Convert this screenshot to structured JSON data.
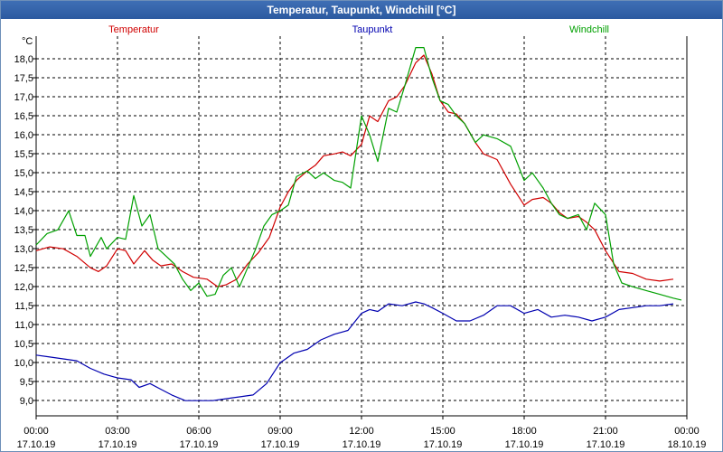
{
  "window": {
    "title": "Temperatur, Taupunkt, Windchill [°C]"
  },
  "chart_data": {
    "type": "line",
    "title": "Temperatur, Taupunkt, Windchill [°C]",
    "ylabel": "°C",
    "ylim": [
      8.6,
      18.6
    ],
    "y_ticks": [
      "9,0",
      "9,5",
      "10,0",
      "10,5",
      "11,0",
      "11,5",
      "12,0",
      "12,5",
      "13,0",
      "13,5",
      "14,0",
      "14,5",
      "15,0",
      "15,5",
      "16,0",
      "16,5",
      "17,0",
      "17,5",
      "18,0"
    ],
    "y_tick_values": [
      9.0,
      9.5,
      10.0,
      10.5,
      11.0,
      11.5,
      12.0,
      12.5,
      13.0,
      13.5,
      14.0,
      14.5,
      15.0,
      15.5,
      16.0,
      16.5,
      17.0,
      17.5,
      18.0
    ],
    "xlim": [
      0,
      24
    ],
    "x_ticks": [
      {
        "time": "00:00",
        "date": "17.10.19"
      },
      {
        "time": "03:00",
        "date": "17.10.19"
      },
      {
        "time": "06:00",
        "date": "17.10.19"
      },
      {
        "time": "09:00",
        "date": "17.10.19"
      },
      {
        "time": "12:00",
        "date": "17.10.19"
      },
      {
        "time": "15:00",
        "date": "17.10.19"
      },
      {
        "time": "18:00",
        "date": "17.10.19"
      },
      {
        "time": "21:00",
        "date": "17.10.19"
      },
      {
        "time": "00:00",
        "date": "18.10.19"
      }
    ],
    "grid": true,
    "legend_position": "top",
    "series": [
      {
        "name": "Temperatur",
        "color": "#d00000",
        "points": [
          [
            0,
            12.95
          ],
          [
            0.5,
            13.05
          ],
          [
            1,
            13.0
          ],
          [
            1.5,
            12.8
          ],
          [
            2,
            12.5
          ],
          [
            2.3,
            12.4
          ],
          [
            2.6,
            12.55
          ],
          [
            3,
            13.0
          ],
          [
            3.3,
            12.95
          ],
          [
            3.6,
            12.6
          ],
          [
            4,
            12.95
          ],
          [
            4.3,
            12.7
          ],
          [
            4.6,
            12.55
          ],
          [
            5,
            12.6
          ],
          [
            5.4,
            12.4
          ],
          [
            5.8,
            12.25
          ],
          [
            6.3,
            12.2
          ],
          [
            6.7,
            12.0
          ],
          [
            7,
            12.05
          ],
          [
            7.4,
            12.2
          ],
          [
            7.8,
            12.6
          ],
          [
            8.2,
            12.9
          ],
          [
            8.6,
            13.3
          ],
          [
            9,
            14.1
          ],
          [
            9.3,
            14.5
          ],
          [
            9.6,
            14.8
          ],
          [
            10,
            15.05
          ],
          [
            10.3,
            15.2
          ],
          [
            10.6,
            15.45
          ],
          [
            11,
            15.5
          ],
          [
            11.3,
            15.55
          ],
          [
            11.6,
            15.45
          ],
          [
            12,
            15.75
          ],
          [
            12.3,
            16.5
          ],
          [
            12.6,
            16.35
          ],
          [
            13,
            16.9
          ],
          [
            13.3,
            17.0
          ],
          [
            13.6,
            17.3
          ],
          [
            14,
            17.9
          ],
          [
            14.3,
            18.1
          ],
          [
            14.6,
            17.6
          ],
          [
            14.9,
            16.9
          ],
          [
            15.2,
            16.6
          ],
          [
            15.5,
            16.55
          ],
          [
            15.8,
            16.3
          ],
          [
            16.2,
            15.8
          ],
          [
            16.5,
            15.5
          ],
          [
            17,
            15.35
          ],
          [
            17.5,
            14.7
          ],
          [
            18,
            14.15
          ],
          [
            18.3,
            14.3
          ],
          [
            18.7,
            14.35
          ],
          [
            19,
            14.2
          ],
          [
            19.3,
            13.95
          ],
          [
            19.6,
            13.8
          ],
          [
            20,
            13.85
          ],
          [
            20.3,
            13.7
          ],
          [
            20.6,
            13.5
          ],
          [
            21,
            12.95
          ],
          [
            21.5,
            12.4
          ],
          [
            22,
            12.35
          ],
          [
            22.5,
            12.2
          ],
          [
            23,
            12.15
          ],
          [
            23.5,
            12.2
          ]
        ]
      },
      {
        "name": "Taupunkt",
        "color": "#0000b0",
        "points": [
          [
            0,
            10.2
          ],
          [
            0.5,
            10.15
          ],
          [
            1,
            10.1
          ],
          [
            1.5,
            10.05
          ],
          [
            2,
            9.85
          ],
          [
            2.5,
            9.7
          ],
          [
            3,
            9.6
          ],
          [
            3.5,
            9.55
          ],
          [
            3.8,
            9.35
          ],
          [
            4.2,
            9.45
          ],
          [
            4.6,
            9.3
          ],
          [
            5,
            9.15
          ],
          [
            5.5,
            9.0
          ],
          [
            6,
            9.0
          ],
          [
            6.5,
            9.0
          ],
          [
            7,
            9.05
          ],
          [
            7.5,
            9.1
          ],
          [
            8,
            9.15
          ],
          [
            8.5,
            9.45
          ],
          [
            9,
            10.0
          ],
          [
            9.5,
            10.25
          ],
          [
            10,
            10.35
          ],
          [
            10.5,
            10.6
          ],
          [
            11,
            10.75
          ],
          [
            11.5,
            10.85
          ],
          [
            12,
            11.3
          ],
          [
            12.3,
            11.4
          ],
          [
            12.6,
            11.35
          ],
          [
            13,
            11.55
          ],
          [
            13.5,
            11.5
          ],
          [
            14,
            11.6
          ],
          [
            14.3,
            11.55
          ],
          [
            14.6,
            11.45
          ],
          [
            15,
            11.3
          ],
          [
            15.5,
            11.1
          ],
          [
            16,
            11.1
          ],
          [
            16.5,
            11.25
          ],
          [
            17,
            11.5
          ],
          [
            17.5,
            11.5
          ],
          [
            18,
            11.3
          ],
          [
            18.5,
            11.4
          ],
          [
            19,
            11.2
          ],
          [
            19.5,
            11.25
          ],
          [
            20,
            11.2
          ],
          [
            20.5,
            11.1
          ],
          [
            21,
            11.2
          ],
          [
            21.5,
            11.4
          ],
          [
            22,
            11.45
          ],
          [
            22.5,
            11.5
          ],
          [
            23,
            11.5
          ],
          [
            23.5,
            11.55
          ]
        ]
      },
      {
        "name": "Windchill",
        "color": "#00a000",
        "points": [
          [
            0,
            13.1
          ],
          [
            0.4,
            13.4
          ],
          [
            0.8,
            13.5
          ],
          [
            1.2,
            14.0
          ],
          [
            1.5,
            13.35
          ],
          [
            1.8,
            13.35
          ],
          [
            2,
            12.8
          ],
          [
            2.4,
            13.3
          ],
          [
            2.6,
            13.0
          ],
          [
            3,
            13.3
          ],
          [
            3.3,
            13.25
          ],
          [
            3.6,
            14.4
          ],
          [
            3.9,
            13.6
          ],
          [
            4.2,
            13.9
          ],
          [
            4.5,
            13.0
          ],
          [
            4.8,
            12.8
          ],
          [
            5.1,
            12.6
          ],
          [
            5.4,
            12.2
          ],
          [
            5.7,
            11.9
          ],
          [
            6,
            12.1
          ],
          [
            6.3,
            11.75
          ],
          [
            6.6,
            11.8
          ],
          [
            6.9,
            12.3
          ],
          [
            7.2,
            12.5
          ],
          [
            7.5,
            12.0
          ],
          [
            7.8,
            12.5
          ],
          [
            8.1,
            13.0
          ],
          [
            8.4,
            13.6
          ],
          [
            8.7,
            13.9
          ],
          [
            9,
            14.0
          ],
          [
            9.3,
            14.15
          ],
          [
            9.6,
            14.9
          ],
          [
            10,
            15.05
          ],
          [
            10.3,
            14.85
          ],
          [
            10.6,
            15.0
          ],
          [
            11,
            14.8
          ],
          [
            11.3,
            14.75
          ],
          [
            11.6,
            14.6
          ],
          [
            12,
            16.5
          ],
          [
            12.3,
            16.0
          ],
          [
            12.6,
            15.3
          ],
          [
            13,
            16.7
          ],
          [
            13.3,
            16.6
          ],
          [
            13.6,
            17.3
          ],
          [
            14,
            18.3
          ],
          [
            14.3,
            18.3
          ],
          [
            14.6,
            17.5
          ],
          [
            14.9,
            16.9
          ],
          [
            15.2,
            16.8
          ],
          [
            15.5,
            16.5
          ],
          [
            15.8,
            16.3
          ],
          [
            16.2,
            15.8
          ],
          [
            16.5,
            16.0
          ],
          [
            17,
            15.9
          ],
          [
            17.5,
            15.7
          ],
          [
            18,
            14.8
          ],
          [
            18.3,
            15.0
          ],
          [
            18.7,
            14.6
          ],
          [
            19,
            14.2
          ],
          [
            19.3,
            13.9
          ],
          [
            19.6,
            13.8
          ],
          [
            20,
            13.9
          ],
          [
            20.3,
            13.5
          ],
          [
            20.6,
            14.2
          ],
          [
            21,
            13.9
          ],
          [
            21.3,
            12.6
          ],
          [
            21.6,
            12.1
          ],
          [
            22,
            12.0
          ],
          [
            22.5,
            11.9
          ],
          [
            23,
            11.8
          ],
          [
            23.5,
            11.7
          ],
          [
            23.8,
            11.65
          ]
        ]
      }
    ]
  }
}
